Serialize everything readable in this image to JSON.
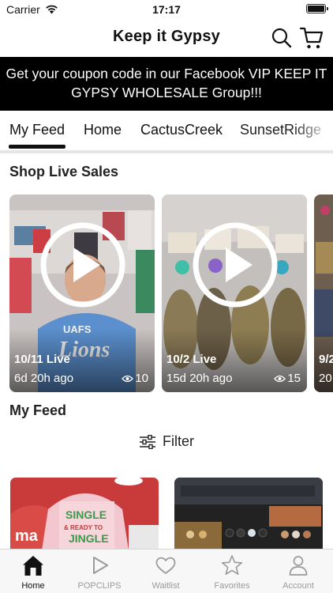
{
  "status_bar": {
    "carrier": "Carrier",
    "time": "17:17"
  },
  "header": {
    "title": "Keep it Gypsy"
  },
  "banner": {
    "text": "Get your coupon code in our Facebook VIP KEEP IT GYPSY WHOLESALE Group!!!"
  },
  "tabs": [
    {
      "label": "My Feed",
      "active": true
    },
    {
      "label": "Home"
    },
    {
      "label": "CactusCreek"
    },
    {
      "label": "SunsetRidge"
    }
  ],
  "live_sales": {
    "title": "Shop Live Sales",
    "cards": [
      {
        "date": "10/11 Live",
        "ago": "6d 20h ago",
        "views": "10"
      },
      {
        "date": "10/2 Live",
        "ago": "15d 20h ago",
        "views": "15"
      },
      {
        "date": "9/2",
        "ago": "20"
      }
    ]
  },
  "feed": {
    "title": "My Feed",
    "filter_label": "Filter"
  },
  "bottom_nav": [
    {
      "label": "Home",
      "icon": "home-icon",
      "active": true
    },
    {
      "label": "POPCLIPS",
      "icon": "play-icon"
    },
    {
      "label": "Waitlist",
      "icon": "heart-icon"
    },
    {
      "label": "Favorites",
      "icon": "star-icon"
    },
    {
      "label": "Account",
      "icon": "account-icon"
    }
  ],
  "colors": {
    "banner_bg": "#000000",
    "active": "#111111",
    "inactive": "#9a9a9a"
  }
}
